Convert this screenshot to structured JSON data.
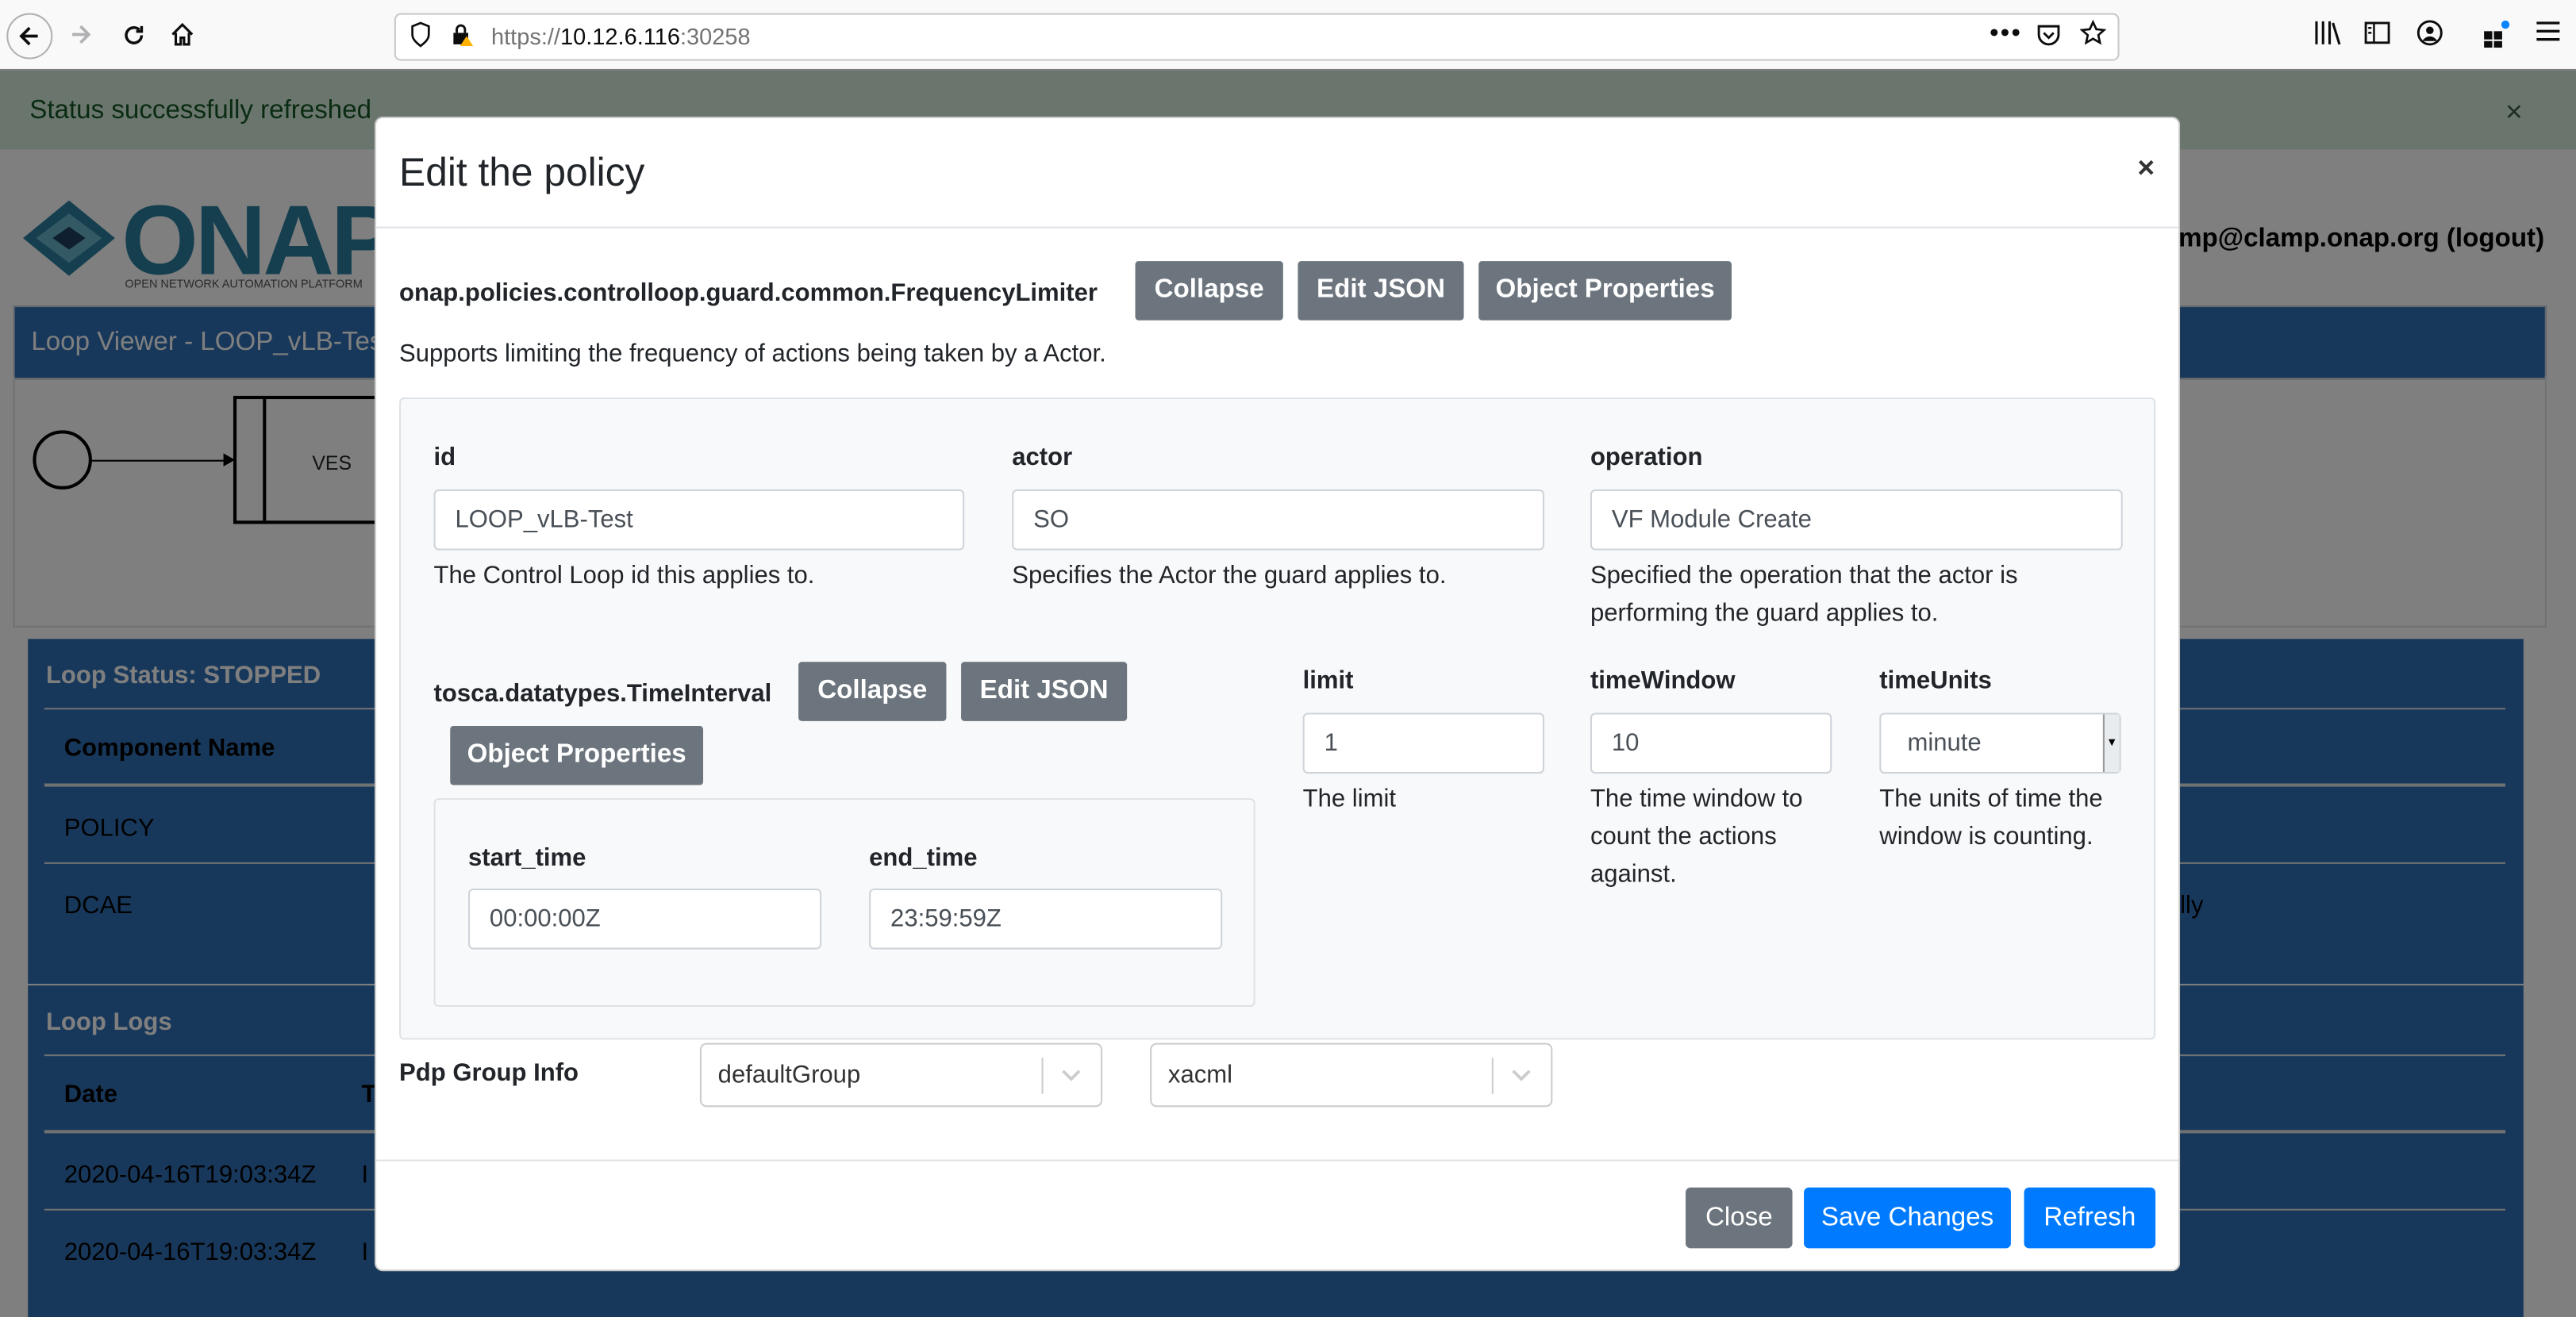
{
  "browser": {
    "url_scheme": "https://",
    "url_host": "10.12.6.116",
    "url_port": ":30258",
    "icons": [
      "back-icon",
      "forward-icon",
      "reload-icon",
      "home-icon",
      "shield-icon",
      "lock-warning-icon",
      "more-icon",
      "pocket-icon",
      "bookmark-star-icon",
      "library-icon",
      "sidebar-icon",
      "account-icon",
      "extensions-icon",
      "menu-icon"
    ]
  },
  "alert": {
    "text": "Status successfully refreshed",
    "close": "×"
  },
  "header": {
    "logo_text": "ONAP",
    "logo_sub": "OPEN NETWORK AUTOMATION PLATFORM",
    "user": "mp@clamp.onap.org (logout)"
  },
  "loop_viewer": {
    "title": "Loop Viewer - LOOP_vLB-Test",
    "ves_label": "VES"
  },
  "loop_status": {
    "title": "Loop Status: STOPPED",
    "col_component": "Component Name",
    "rows": [
      "POLICY",
      "DCAE"
    ],
    "dcae_tail": "lly"
  },
  "loop_logs": {
    "title": "Loop Logs",
    "col_date": "Date",
    "col_t": "T",
    "rows": [
      "2020-04-16T19:03:34Z",
      "2020-04-16T19:03:34Z"
    ],
    "row_tail": "I"
  },
  "modal": {
    "title": "Edit the policy",
    "close": "×",
    "policy_type": "onap.policies.controlloop.guard.common.FrequencyLimiter",
    "btn_collapse": "Collapse",
    "btn_edit_json": "Edit JSON",
    "btn_object_properties": "Object Properties",
    "description": "Supports limiting the frequency of actions being taken by a Actor.",
    "fields": {
      "id": {
        "label": "id",
        "value": "LOOP_vLB-Test",
        "help": "The Control Loop id this applies to."
      },
      "actor": {
        "label": "actor",
        "value": "SO",
        "help": "Specifies the Actor the guard applies to."
      },
      "operation": {
        "label": "operation",
        "value": "VF Module Create",
        "help1": "Specified the operation that the actor is",
        "help2": "performing the guard applies to."
      },
      "limit": {
        "label": "limit",
        "value": "1",
        "help": "The limit"
      },
      "timeWindow": {
        "label": "timeWindow",
        "value": "10",
        "help1": "The time window to",
        "help2": "count the actions",
        "help3": "against."
      },
      "timeUnits": {
        "label": "timeUnits",
        "value": "minute",
        "help1": "The units of time the",
        "help2": "window is counting."
      }
    },
    "time_interval": {
      "type": "tosca.datatypes.TimeInterval",
      "start_time": {
        "label": "start_time",
        "value": "00:00:00Z"
      },
      "end_time": {
        "label": "end_time",
        "value": "23:59:59Z"
      }
    },
    "pdp": {
      "label": "Pdp Group Info",
      "group": "defaultGroup",
      "subgroup": "xacml"
    },
    "footer": {
      "close": "Close",
      "save": "Save Changes",
      "refresh": "Refresh"
    }
  },
  "colors": {
    "primary": "#007bff",
    "secondary": "#6c757d",
    "header_blue": "#3071b7",
    "alert_green": "#d4edda"
  }
}
